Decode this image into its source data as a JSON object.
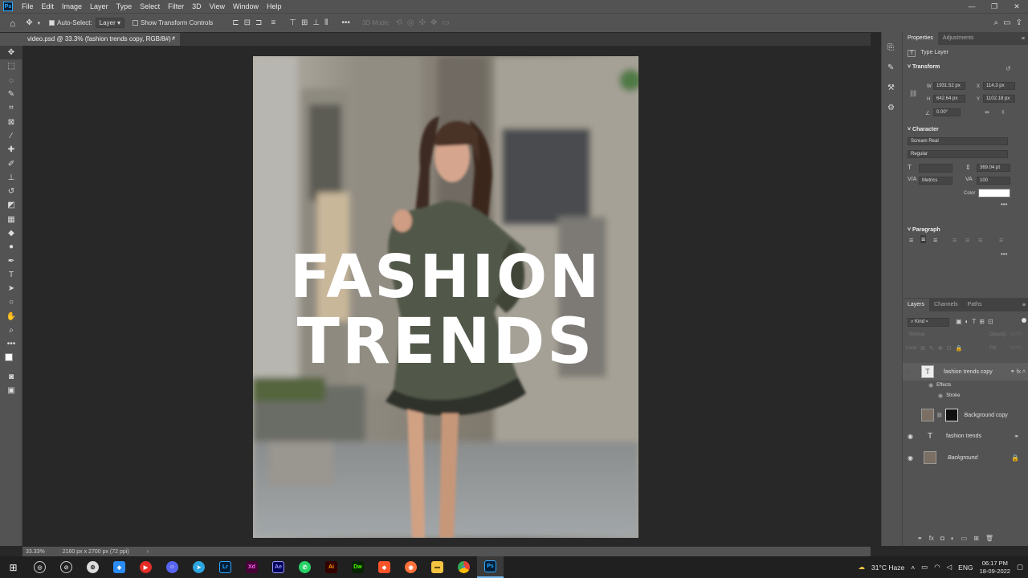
{
  "menubar": {
    "app_logo": "Ps",
    "items": [
      "File",
      "Edit",
      "Image",
      "Layer",
      "Type",
      "Select",
      "Filter",
      "3D",
      "View",
      "Window",
      "Help"
    ],
    "window_controls": [
      "—",
      "❐",
      "✕"
    ]
  },
  "options": {
    "auto_select_label": "Auto-Select:",
    "auto_select_checked": true,
    "auto_select_target": "Layer",
    "show_transform_label": "Show Transform Controls",
    "show_transform_checked": false,
    "mode_label": "3D Mode:"
  },
  "document": {
    "tab_title": "video.psd @ 33.3% (fashion trends copy, RGB/8#) *",
    "headline_line1": "FASHION",
    "headline_line2": "TRENDS"
  },
  "status": {
    "zoom": "33.33%",
    "doc_size": "2160 px x 2700 px (72 ppi)"
  },
  "tools": [
    "move-tool",
    "marquee-tool",
    "lasso-tool",
    "quick-select-tool",
    "crop-tool",
    "frame-tool",
    "eyedropper-tool",
    "healing-tool",
    "brush-tool",
    "clone-stamp-tool",
    "history-brush-tool",
    "eraser-tool",
    "gradient-tool",
    "blur-tool",
    "dodge-tool",
    "pen-tool",
    "type-tool",
    "path-select-tool",
    "ellipse-tool",
    "hand-tool",
    "zoom-tool",
    "more-tools"
  ],
  "properties": {
    "tabs": [
      "Properties",
      "Adjustments"
    ],
    "layer_type": "Type Layer",
    "transform_title": "Transform",
    "w_label": "W",
    "w_value": "1931.52 px",
    "h_label": "H",
    "h_value": "642.64 px",
    "x_label": "X",
    "x_value": "114.3 px",
    "y_label": "Y",
    "y_value": "1102.18 px",
    "angle_value": "0.00°",
    "character_title": "Character",
    "font_family": "Scream Real",
    "font_style": "Regular",
    "leading_value": "369.04 pt",
    "kerning_value": "Metrics",
    "tracking_value": "100",
    "color_label": "Color",
    "text_color": "#ffffff",
    "paragraph_title": "Paragraph"
  },
  "layers": {
    "tabs": [
      "Layers",
      "Channels",
      "Paths"
    ],
    "filter_kind": "Kind",
    "blend_mode": "Normal",
    "opacity_label": "Opacity:",
    "opacity_value": "100%",
    "lock_label": "Lock:",
    "fill_label": "Fill:",
    "fill_value": "100%",
    "items": [
      {
        "name": "fashion trends copy",
        "visible": false,
        "type": "text",
        "selected": true
      },
      {
        "name": "Effects",
        "visible": false,
        "type": "effects"
      },
      {
        "name": "Stroke",
        "visible": false,
        "type": "effect"
      },
      {
        "name": "Background copy",
        "visible": false,
        "type": "masked"
      },
      {
        "name": "fashion trends",
        "visible": true,
        "type": "text"
      },
      {
        "name": "Background",
        "visible": true,
        "type": "image",
        "locked": true
      }
    ]
  },
  "taskbar": {
    "apps": [
      "windows-icon",
      "chrome-alt-icon",
      "vlc-app-icon",
      "steam-icon",
      "vpn-icon",
      "youtube-icon",
      "discord-icon",
      "telegram-icon",
      "lightroom-icon",
      "xd-icon",
      "after-effects-icon",
      "whatsapp-icon",
      "illustrator-icon",
      "dreamweaver-icon",
      "brave-icon",
      "firefox-icon",
      "files-icon",
      "chrome-icon",
      "photoshop-icon"
    ],
    "weather": "31°C  Haze",
    "language": "ENG",
    "time": "06:17 PM",
    "date": "18-09-2022"
  }
}
